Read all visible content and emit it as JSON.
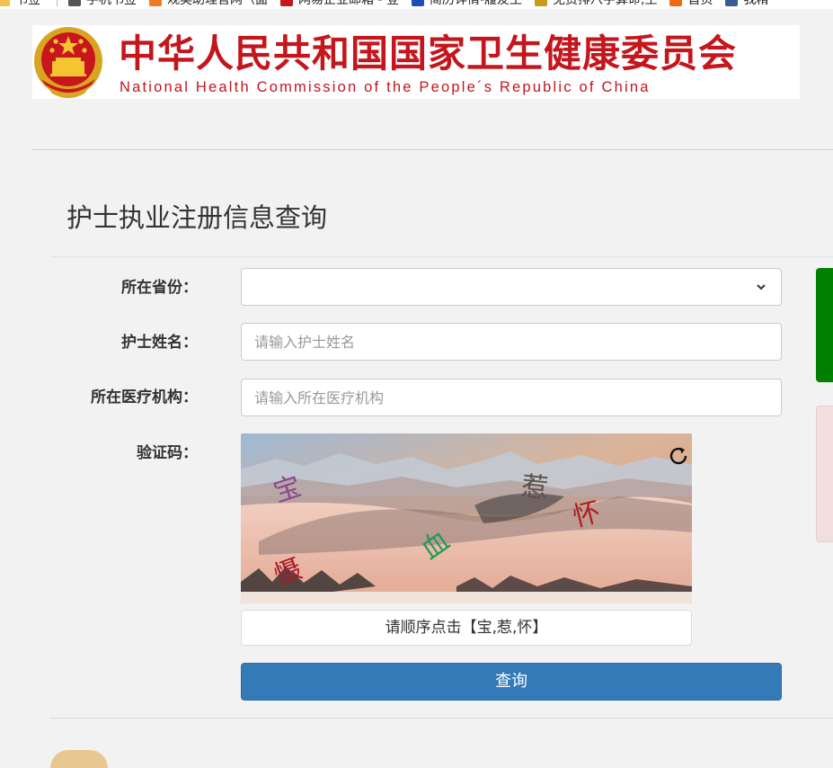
{
  "bookmarks": [
    {
      "label": "书签",
      "icon": "folder-icon",
      "color": "#f2c14e"
    },
    {
      "label": "手机书签",
      "icon": "phone-icon",
      "color": "#555555"
    },
    {
      "label": "观奕助理官网（面",
      "icon": "diamond-icon",
      "color": "#ee7b22"
    },
    {
      "label": "网易企业邮箱 - 登",
      "icon": "netease-icon",
      "color": "#c4161c"
    },
    {
      "label": "简历详情-履友主",
      "icon": "resume-icon",
      "color": "#1a4fb7"
    },
    {
      "label": "免费排八字算命,生",
      "icon": "bazi-icon",
      "color": "#c69a1c"
    },
    {
      "label": "首页",
      "icon": "home-icon",
      "color": "#f06a14"
    },
    {
      "label": "我精",
      "icon": "facebook-icon",
      "color": "#3b5998"
    }
  ],
  "header": {
    "title_cn": "中华人民共和国国家卫生健康委员会",
    "title_en": "National Health Commission of the People´s Republic of China",
    "brand_color": "#c4161c"
  },
  "form": {
    "title": "护士执业注册信息查询",
    "province": {
      "label": "所在省份：",
      "value": ""
    },
    "name": {
      "label": "护士姓名：",
      "placeholder": "请输入护士姓名"
    },
    "institution": {
      "label": "所在医疗机构：",
      "placeholder": "请输入所在医疗机构"
    },
    "captcha": {
      "label": "验证码：",
      "chars": [
        {
          "text": "宝",
          "color": "#8a4b8c"
        },
        {
          "text": "惹",
          "color": "#5e5048"
        },
        {
          "text": "怀",
          "color": "#b01e1e"
        },
        {
          "text": "血",
          "color": "#1f9a58"
        },
        {
          "text": "慑",
          "color": "#a8192a"
        }
      ],
      "hint": "请顺序点击【宝,惹,怀】"
    },
    "submit_label": "查询",
    "accent_color": "#337ab7"
  },
  "side": {
    "success_color": "#008000",
    "error_color": "#f2dede"
  }
}
